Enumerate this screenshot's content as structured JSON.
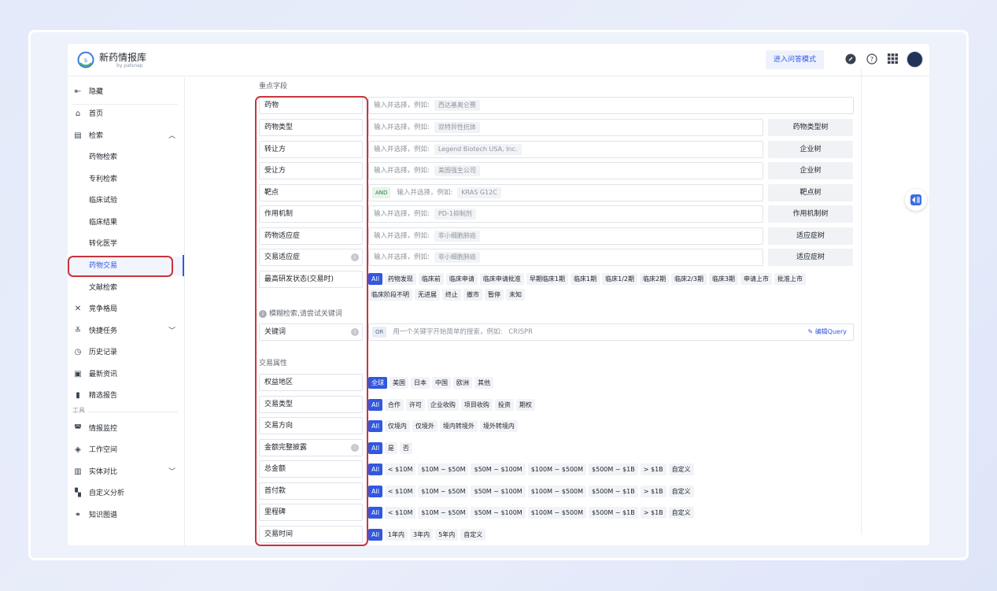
{
  "app": {
    "title": "新药情报库",
    "subtitle": "by patsnap"
  },
  "topbar": {
    "qa_button": "进入问答模式",
    "icons": [
      "link-icon",
      "help-icon",
      "apps-grid-icon"
    ]
  },
  "sidebar": {
    "hide": "隐藏",
    "items": [
      {
        "label": "首页",
        "icon": "home-icon"
      },
      {
        "label": "检索",
        "icon": "search-doc-icon"
      },
      {
        "label": "药物检索"
      },
      {
        "label": "专利检索"
      },
      {
        "label": "临床试验"
      },
      {
        "label": "临床结果"
      },
      {
        "label": "转化医学"
      },
      {
        "label": "药物交易"
      },
      {
        "label": "文献检索"
      },
      {
        "label": "竞争格局",
        "icon": "competition-icon"
      },
      {
        "label": "快捷任务",
        "icon": "task-icon"
      },
      {
        "label": "历史记录",
        "icon": "history-icon"
      },
      {
        "label": "最新资讯",
        "icon": "news-icon"
      },
      {
        "label": "精选报告",
        "icon": "report-icon"
      },
      {
        "label": "情报监控",
        "icon": "monitor-icon"
      },
      {
        "label": "工作空间",
        "icon": "workspace-icon"
      },
      {
        "label": "实体对比",
        "icon": "compare-icon"
      },
      {
        "label": "自定义分析",
        "icon": "analysis-icon"
      },
      {
        "label": "知识图谱",
        "icon": "graph-icon"
      }
    ],
    "tools_header": "工具"
  },
  "main": {
    "section_key": "重点字段",
    "fields": [
      {
        "label": "药物",
        "placeholder": "输入并选择，例如:",
        "example": "西达基奥仑赛"
      },
      {
        "label": "药物类型",
        "placeholder": "输入并选择，例如:",
        "example": "双特异性抗体",
        "button": "药物类型树"
      },
      {
        "label": "转让方",
        "placeholder": "输入并选择，例如:",
        "example": "Legend Biotech USA, Inc.",
        "button": "企业树"
      },
      {
        "label": "受让方",
        "placeholder": "输入并选择，例如:",
        "example": "美国强生公司",
        "button": "企业树"
      },
      {
        "label": "靶点",
        "tag": "AND",
        "placeholder": "输入并选择，例如:",
        "example": "KRAS G12C",
        "button": "靶点树"
      },
      {
        "label": "作用机制",
        "placeholder": "输入并选择，例如:",
        "example": "PD-1抑制剂",
        "button": "作用机制树"
      },
      {
        "label": "药物适应症",
        "placeholder": "输入并选择，例如:",
        "example": "非小细胞肺癌",
        "button": "适应症树"
      },
      {
        "label": "交易适应症",
        "placeholder": "输入并选择，例如:",
        "example": "非小细胞肺癌",
        "button": "适应症树"
      }
    ],
    "phase": {
      "label": "最高研发状态(交易时)",
      "options_row1": [
        "All",
        "药物发现",
        "临床前",
        "临床申请",
        "临床申请批准",
        "早期临床1期",
        "临床1期",
        "临床1/2期",
        "临床2期",
        "临床2/3期",
        "临床3期",
        "申请上市",
        "批准上市"
      ],
      "options_row2": [
        "临床阶段不明",
        "无进展",
        "终止",
        "撤市",
        "暂停",
        "未知"
      ]
    },
    "fuzzy_hint": "模糊检索,请尝试关键词",
    "keyword": {
      "label": "关键词",
      "tag": "OR",
      "placeholder": "用一个关键字开始简单的搜索，例如:",
      "example": "CRISPR",
      "edit": "编辑Query"
    },
    "section_deal": "交易属性",
    "deal_fields": [
      {
        "label": "权益地区",
        "options": [
          "全球",
          "美国",
          "日本",
          "中国",
          "欧洲",
          "其他"
        ]
      },
      {
        "label": "交易类型",
        "options": [
          "All",
          "合作",
          "许可",
          "企业收购",
          "项目收购",
          "投资",
          "期权"
        ]
      },
      {
        "label": "交易方向",
        "options": [
          "All",
          "仅境内",
          "仅境外",
          "境内转境外",
          "境外转境内"
        ]
      },
      {
        "label": "金额完整披露",
        "options": [
          "All",
          "是",
          "否"
        ]
      },
      {
        "label": "总金额",
        "options": [
          "All",
          "< $10M",
          "$10M ~ $50M",
          "$50M ~ $100M",
          "$100M ~ $500M",
          "$500M ~ $1B",
          "> $1B",
          "自定义"
        ]
      },
      {
        "label": "首付款",
        "options": [
          "All",
          "< $10M",
          "$10M ~ $50M",
          "$50M ~ $100M",
          "$100M ~ $500M",
          "$500M ~ $1B",
          "> $1B",
          "自定义"
        ]
      },
      {
        "label": "里程碑",
        "options": [
          "All",
          "< $10M",
          "$10M ~ $50M",
          "$50M ~ $100M",
          "$100M ~ $500M",
          "$500M ~ $1B",
          "> $1B",
          "自定义"
        ]
      },
      {
        "label": "交易时间",
        "options": [
          "All",
          "1年内",
          "3年内",
          "5年内",
          "自定义"
        ]
      }
    ]
  },
  "colors": {
    "accent": "#3258e0",
    "highlight": "#c9343b"
  }
}
